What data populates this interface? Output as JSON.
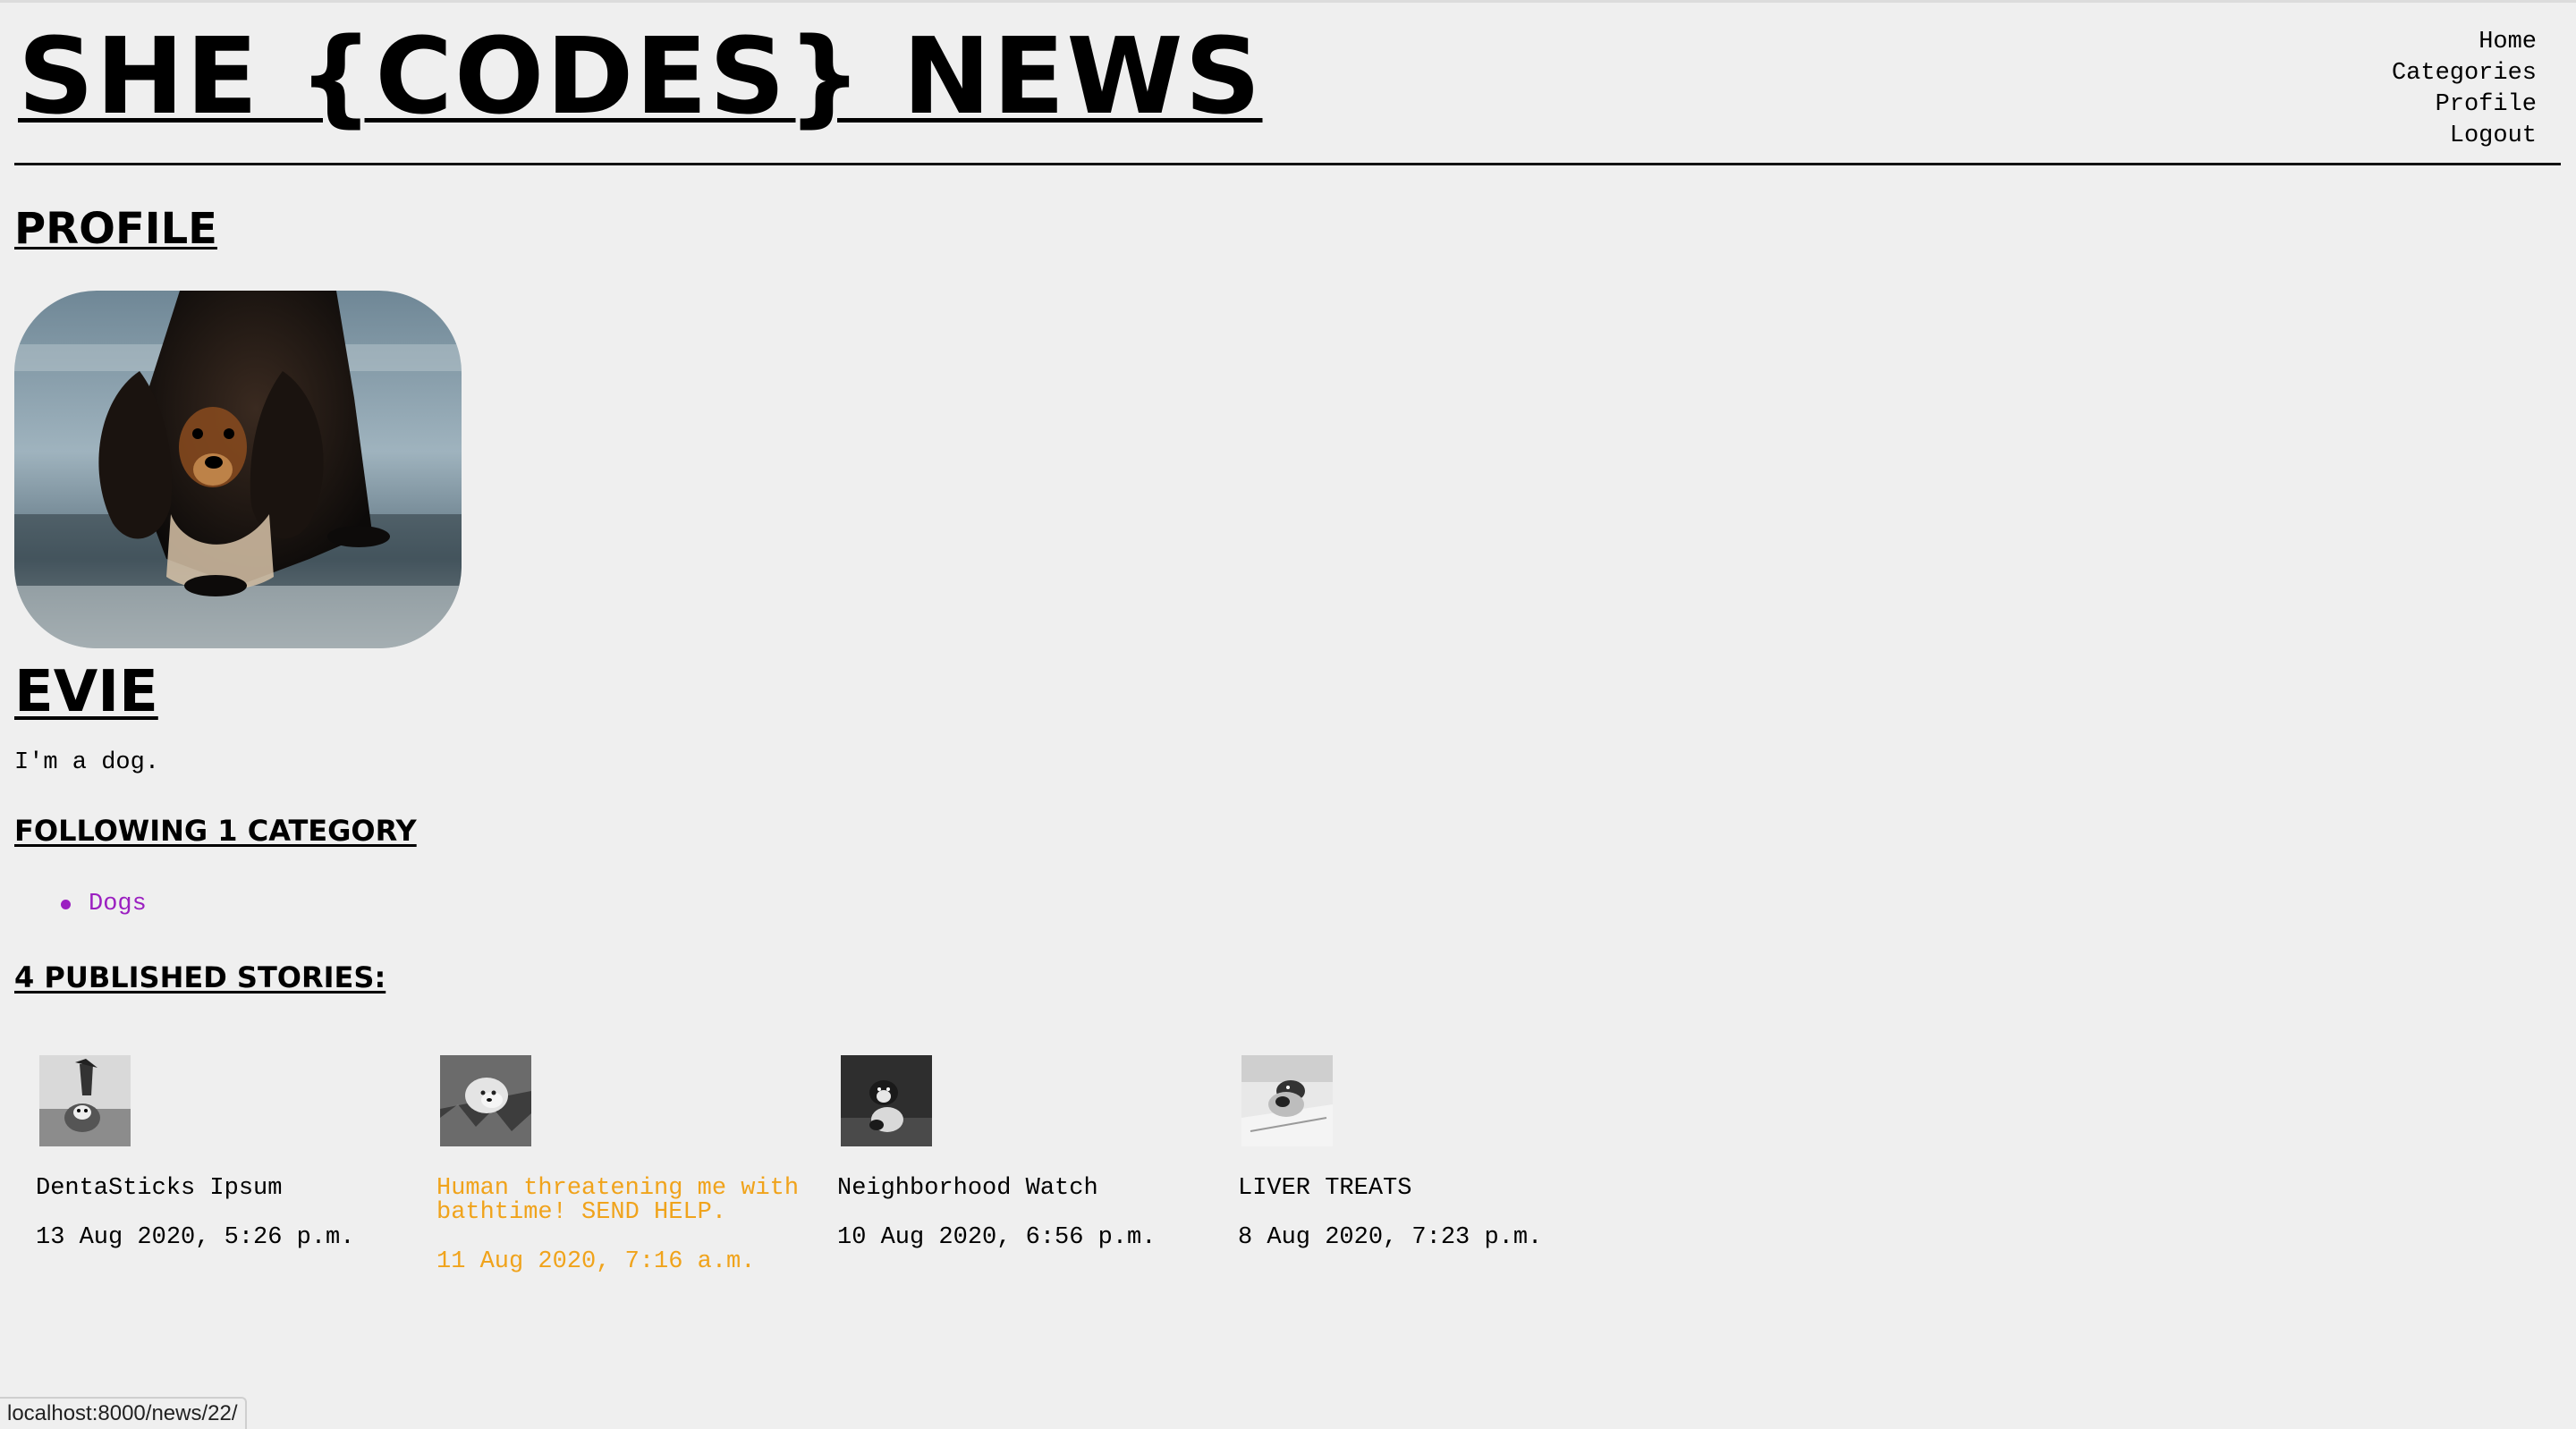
{
  "site": {
    "title": "SHE {CODES} NEWS"
  },
  "nav": {
    "items": [
      "Home",
      "Categories",
      "Profile",
      "Logout"
    ]
  },
  "profile": {
    "heading": "PROFILE",
    "name": "EVIE",
    "bio": "I'm a dog.",
    "avatar_icon": "dog-photo"
  },
  "following": {
    "heading": "FOLLOWING 1 CATEGORY",
    "categories": [
      "Dogs"
    ]
  },
  "stories": {
    "heading": "4 PUBLISHED STORIES:",
    "items": [
      {
        "title": "DentaSticks Ipsum",
        "date": "13 Aug 2020, 5:26 p.m."
      },
      {
        "title": "Human threatening me with\nbathtime! SEND HELP.",
        "date": "11 Aug 2020, 7:16 a.m."
      },
      {
        "title": "Neighborhood Watch",
        "date": "10 Aug 2020, 6:56 p.m."
      },
      {
        "title": "LIVER TREATS",
        "date": "8 Aug 2020, 7:23 p.m."
      }
    ]
  },
  "status_bar": {
    "url": "localhost:8000/news/22/"
  },
  "colors": {
    "background": "#efefef",
    "link_visited": "#9b1fc1",
    "hover_accent": "#f0a31b"
  }
}
